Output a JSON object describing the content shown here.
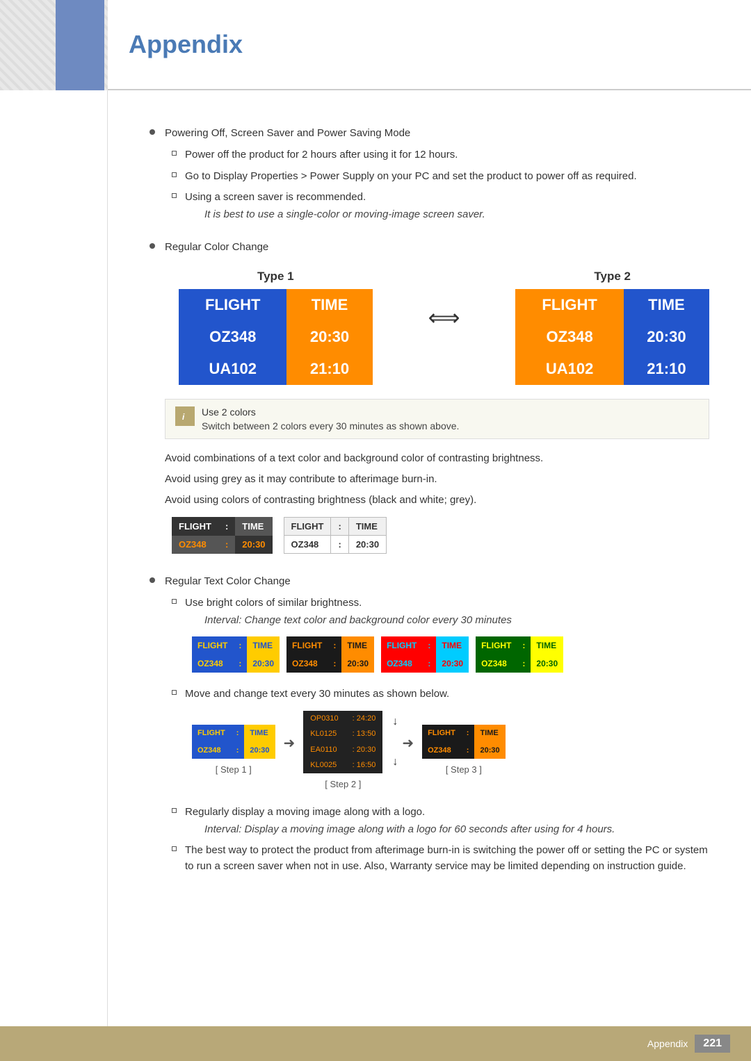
{
  "header": {
    "title": "Appendix"
  },
  "footer": {
    "label": "Appendix",
    "page_number": "221"
  },
  "content": {
    "bullet1": {
      "label": "Powering Off, Screen Saver and Power Saving Mode",
      "sub1": "Power off the product for 2 hours after using it for 12 hours.",
      "sub2": "Go to Display Properties > Power Supply on your PC and set the product to power off as required.",
      "sub3": "Using a screen saver is recommended.",
      "sub3_note": "It is best to use a single-color or moving-image screen saver."
    },
    "bullet2": {
      "label": "Regular Color Change"
    },
    "type1_label": "Type 1",
    "type2_label": "Type 2",
    "type1": {
      "header_col1": "FLIGHT",
      "header_col2": "TIME",
      "row1_col1": "OZ348",
      "row1_col2": "20:30",
      "row2_col1": "UA102",
      "row2_col2": "21:10"
    },
    "type2": {
      "header_col1": "FLIGHT",
      "header_col2": "TIME",
      "row1_col1": "OZ348",
      "row1_col2": "20:30",
      "row2_col1": "UA102",
      "row2_col2": "21:10"
    },
    "note1_title": "Use 2 colors",
    "note1_body": "Switch between 2 colors every 30 minutes as shown above.",
    "avoid1": "Avoid combinations of a text color and background color of contrasting brightness.",
    "avoid2": "Avoid using grey as it may contribute to afterimage burn-in.",
    "avoid3": "Avoid using colors of contrasting brightness (black and white; grey).",
    "dark_table": {
      "h1": "FLIGHT",
      "h2": ":",
      "h3": "TIME",
      "d1": "OZ348",
      "d2": ":",
      "d3": "20:30"
    },
    "light_table": {
      "h1": "FLIGHT",
      "h2": ":",
      "h3": "TIME",
      "d1": "OZ348",
      "d2": ":",
      "d3": "20:30"
    },
    "bullet3": {
      "label": "Regular Text Color Change",
      "sub1": "Use bright colors of similar brightness.",
      "sub1_note": "Interval: Change text color and background color every 30 minutes"
    },
    "four_tables": [
      {
        "h1": "FLIGHT",
        "h2": ":",
        "h3": "TIME",
        "d1": "OZ348",
        "d2": ":",
        "d3": "20:30"
      },
      {
        "h1": "FLIGHT",
        "h2": ":",
        "h3": "TIME",
        "d1": "OZ348",
        "d2": ":",
        "d3": "20:30"
      },
      {
        "h1": "FLIGHT",
        "h2": ":",
        "h3": "TIME",
        "d1": "OZ348",
        "d2": ":",
        "d3": "20:30"
      },
      {
        "h1": "FLIGHT",
        "h2": ":",
        "h3": "TIME",
        "d1": "OZ348",
        "d2": ":",
        "d3": "20:30"
      }
    ],
    "sub2_move": "Move and change text every 30 minutes as shown below.",
    "step1_label": "[ Step 1 ]",
    "step2_label": "[ Step 2 ]",
    "step3_label": "[ Step 3 ]",
    "step1_table": {
      "h1": "FLIGHT",
      "h2": ":",
      "h3": "TIME",
      "d1": "OZ348",
      "d2": ":",
      "d3": "20:30"
    },
    "step2_rows": [
      {
        "c1": "OP0310",
        "c2": "24:20"
      },
      {
        "c1": "KL0125",
        "c2": "13:50"
      },
      {
        "c1": "EA0110",
        "c2": "20:30"
      },
      {
        "c1": "KL0025",
        "c2": "16:50"
      }
    ],
    "step3_table": {
      "h1": "FLIGHT",
      "h2": ":",
      "h3": "TIME",
      "d1": "OZ348",
      "d2": ":",
      "d3": "20:30"
    },
    "sub3_regularly": "Regularly display a moving image along with a logo.",
    "sub3_interval": "Interval: Display a moving image along with a logo for 60 seconds after using for 4 hours.",
    "sub4_best": "The best way to protect the product from afterimage burn-in is switching the power off or setting the PC or system to run a screen saver when not in use. Also, Warranty service may be limited depending on instruction guide."
  }
}
